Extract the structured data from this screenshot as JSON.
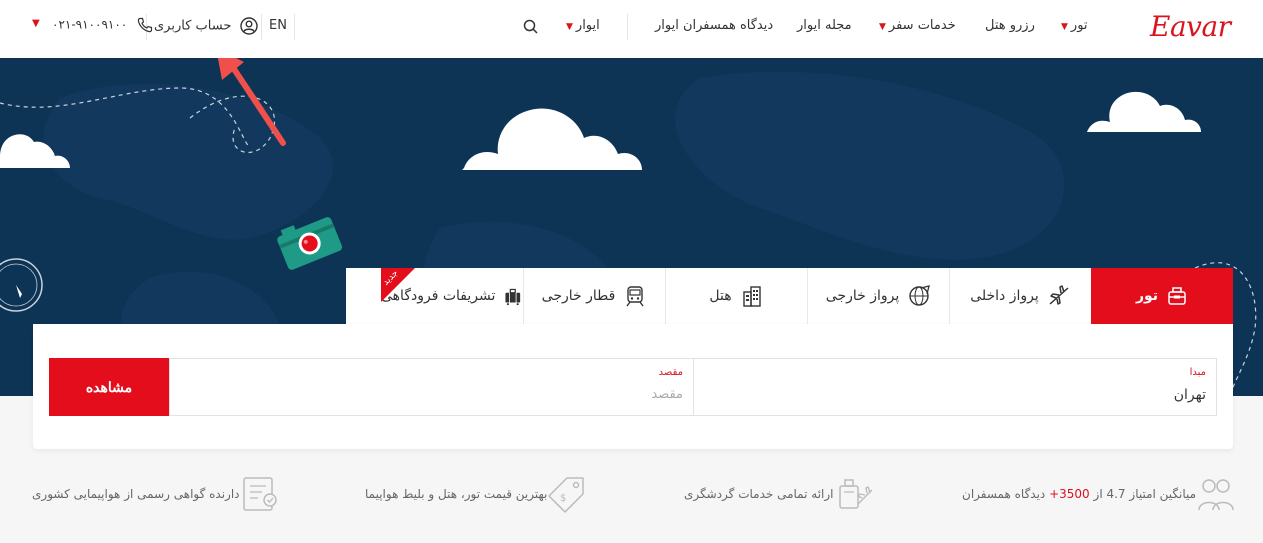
{
  "brand": {
    "logo": "Eavar"
  },
  "nav": {
    "tour": "تور",
    "hotel": "رزرو هتل",
    "services": "خدمات سفر",
    "magazine": "مجله ایوار",
    "reviews": "دیدگاه همسفران ایوار",
    "eavar": "ایوار"
  },
  "header": {
    "lang": "EN",
    "account": "حساب کاربری",
    "phone": "۰۲۱-۹۱۰۰۹۱۰۰"
  },
  "tabs": [
    {
      "label": "تور",
      "icon": "tour-bag-icon",
      "active": true
    },
    {
      "label": "پرواز داخلی",
      "icon": "airplane-icon"
    },
    {
      "label": "پرواز خارجی",
      "icon": "globe-plane-icon"
    },
    {
      "label": "هتل",
      "icon": "building-icon"
    },
    {
      "label": "قطار خارجی",
      "icon": "train-icon"
    },
    {
      "label": "تشریفات فرودگاهی",
      "icon": "luggage-icon",
      "badge": "جدید"
    }
  ],
  "search": {
    "origin_label": "مبدا",
    "origin_value": "تهران",
    "dest_label": "مقصد",
    "dest_placeholder": "مقصد",
    "submit": "مشاهده"
  },
  "features": {
    "rating_prefix": "میانگین امتیاز 4.7 از",
    "rating_count": "3500+",
    "rating_suffix": "دیدگاه همسفران",
    "services": "ارائه تمامی خدمات گردشگری",
    "price": "بهترین قیمت تور، هتل و بلیط هواپیما",
    "license": "دارنده گواهی رسمی از هواپیمایی کشوری"
  },
  "colors": {
    "brand_red": "#e30d1c",
    "hero_navy": "#0d3355",
    "annotation_arrow": "#f0504c"
  }
}
